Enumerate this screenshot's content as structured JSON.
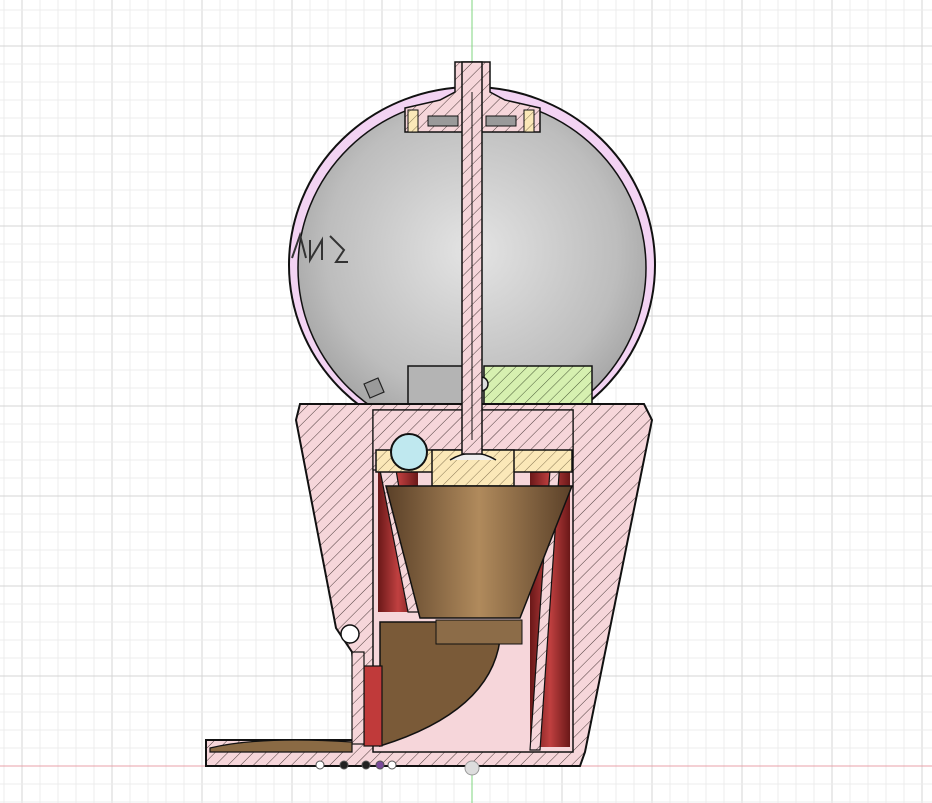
{
  "viewport": {
    "background": "#ffffff",
    "grid_minor_color": "#ececec",
    "grid_major_color": "#d4d4d4",
    "axis_vertical_color": "#7fd67f",
    "axis_horizontal_color": "#e8a0a8"
  },
  "model": {
    "section_fill": "#f6d6da",
    "hatch_color": "#222222",
    "sphere_glass_color": "#c8c8c8",
    "sphere_shell_color": "#f3d3f3",
    "inner_red_color": "#b03030",
    "funnel_color": "#8a6a44",
    "chute_color": "#7a5a38",
    "bearing_color": "#fbe8b8",
    "ball_color": "#bfe8ef",
    "board_color": "#d6f0b0"
  },
  "toolbar": {
    "markers": [
      "point-marker",
      "point-marker",
      "point-marker",
      "point-marker",
      "point-marker"
    ]
  }
}
